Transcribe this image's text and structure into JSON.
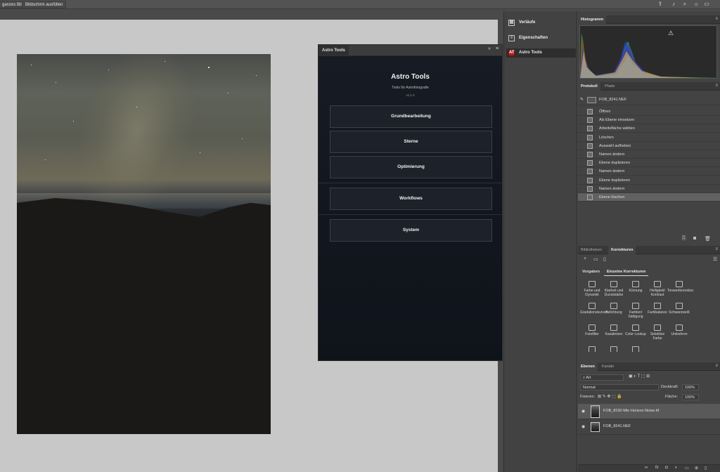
{
  "topbar": {
    "buttons": [
      "ganzes Bild",
      "Bildschirm ausfüllen"
    ]
  },
  "astro": {
    "tab_label": "Astro Tools",
    "title": "Astro Tools",
    "subtitle": "Tools für Astrofotografie",
    "version": "v1.1.2",
    "buttons": [
      "Grundbearbeitung",
      "Sterne",
      "Optimierung",
      "Workflows",
      "System"
    ]
  },
  "dock": {
    "items": [
      {
        "label": "Verläufe",
        "icon": "gradient-icon"
      },
      {
        "label": "Eigenschaften",
        "icon": "properties-icon"
      },
      {
        "label": "Astro Tools",
        "icon": "astro-tools-icon"
      }
    ],
    "active_index": 2
  },
  "histogram": {
    "tab": "Histogramm"
  },
  "history": {
    "tabs": [
      "Protokoll",
      "Pfade"
    ],
    "snapshot": "FOB_8241.NEF",
    "steps": [
      "Öffnen",
      "Als Ebene einsetzen",
      "Arbeitsfläche wählen",
      "Löschen",
      "Auswahl aufheben",
      "Namen ändern",
      "Ebene duplizieren",
      "Namen ändern",
      "Ebene duplizieren",
      "Namen ändern",
      "Ebene löschen"
    ],
    "selected_index": 10
  },
  "corrections": {
    "tabs": [
      "Bibliotheken",
      "Korrekturen"
    ],
    "subtabs": [
      "Vorgaben",
      "Einzelne Korrekturen"
    ],
    "items": [
      "Farbe und Dynamik",
      "Klarheit und Dunststärke",
      "Körnung",
      "Helligkeit/ Kontrast",
      "Tonwertkorrektur",
      "Gradationskurven",
      "Belichtung",
      "Farbton/ Sättigung",
      "Farbbalance",
      "Schwarzweiß",
      "Fotofilter",
      "Kanalmixer",
      "Color Lookup",
      "Selektive Farbe",
      "Umkehren",
      "Tontrennung",
      "Schwellenwert",
      "Verlaufsumsetzung"
    ]
  },
  "layers": {
    "tabs": [
      "Ebenen",
      "Kanäle"
    ],
    "filter": "Art",
    "blend_mode": "Normal",
    "opacity_label": "Deckkraft:",
    "opacity": "100%",
    "fill_label": "Fläche:",
    "fill": "100%",
    "lock_label": "Fixieren:",
    "rows": [
      "FOB_8192-Min Horizon Noise.tif",
      "FOB_8241.NEF"
    ],
    "selected_index": 0
  }
}
